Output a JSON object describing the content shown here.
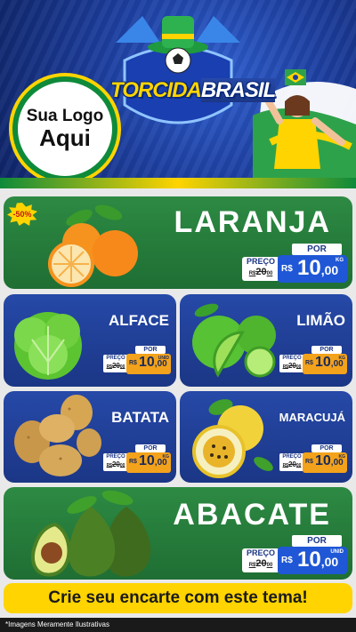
{
  "header": {
    "logo_line1": "Sua Logo",
    "logo_line2": "Aqui",
    "badge_part1": "TORCIDA",
    "badge_part2": "BRASIL"
  },
  "labels": {
    "por": "POR",
    "preco": "PREÇO",
    "currency": "R$",
    "old_price_whole": "20",
    "old_price_dec": "00"
  },
  "products": {
    "laranja": {
      "name": "LARANJA",
      "discount": "-50%",
      "price_whole": "10",
      "price_dec": ",00",
      "unit": "KG"
    },
    "alface": {
      "name": "ALFACE",
      "price_whole": "10",
      "price_dec": ",00",
      "unit": "UNID"
    },
    "limao": {
      "name": "LIMÃO",
      "price_whole": "10",
      "price_dec": ",00",
      "unit": "KG"
    },
    "batata": {
      "name": "BATATA",
      "price_whole": "10",
      "price_dec": ",00",
      "unit": "KG"
    },
    "maracuja": {
      "name": "MARACUJÁ",
      "price_whole": "10",
      "price_dec": ",00",
      "unit": "KG"
    },
    "abacate": {
      "name": "ABACATE",
      "price_whole": "10",
      "price_dec": ",00",
      "unit": "UNID"
    }
  },
  "banner": {
    "text": "Crie seu encarte com este tema!"
  },
  "footer": {
    "note": "*Imagens Meramente Ilustrativas"
  },
  "colors": {
    "green_card": "#2d8a43",
    "blue_card": "#2649a8",
    "price_blue": "#1f57d6",
    "price_orange": "#f3a21b",
    "banner_yellow": "#ffd400"
  }
}
